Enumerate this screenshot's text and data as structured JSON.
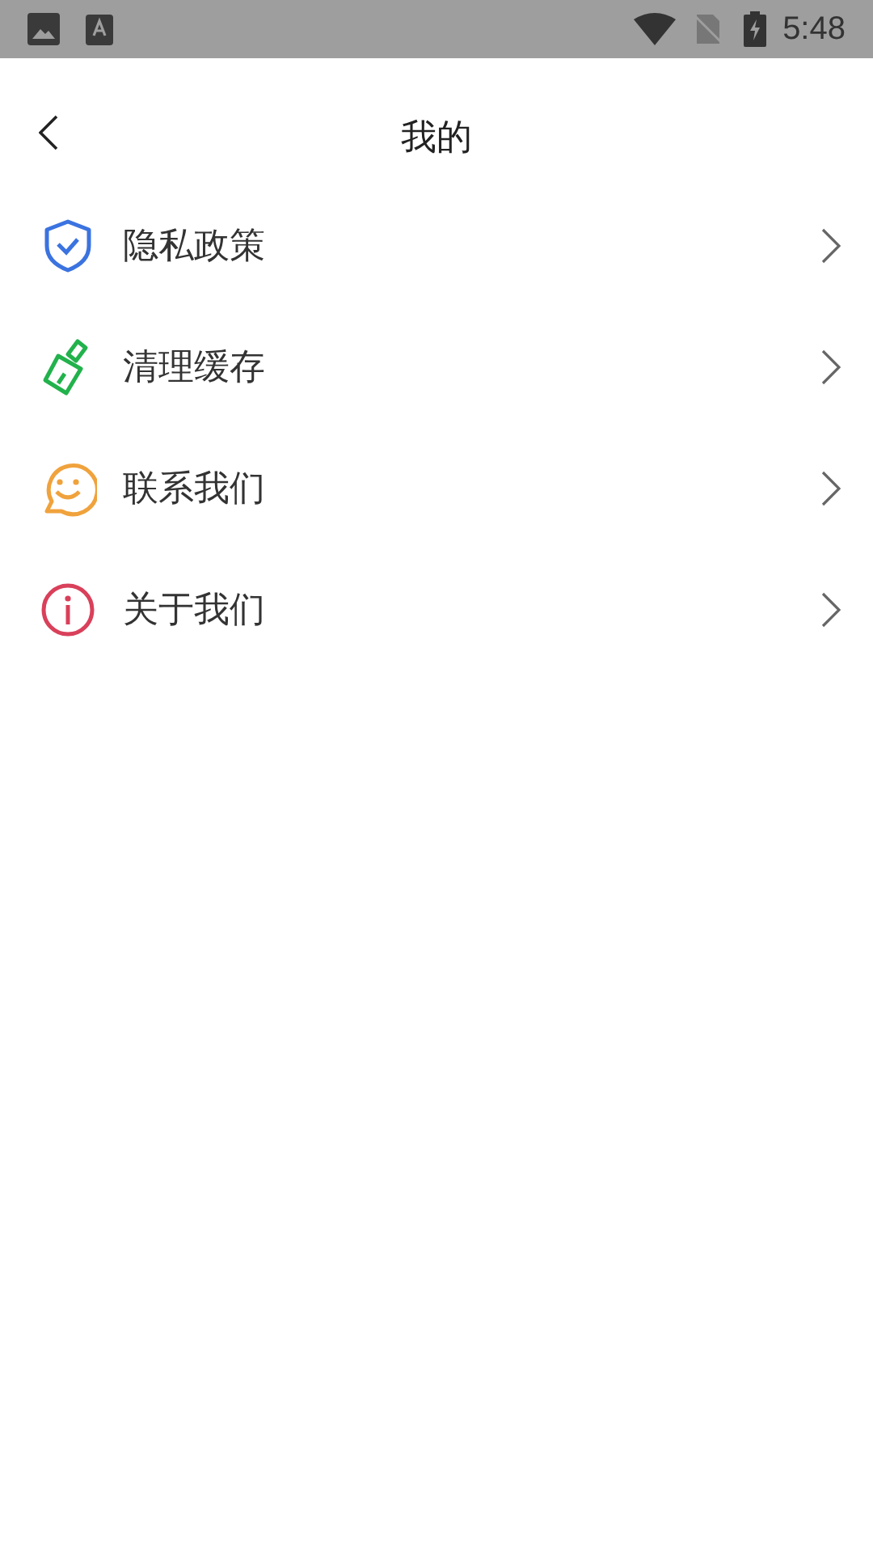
{
  "status_bar": {
    "time": "5:48"
  },
  "header": {
    "title": "我的"
  },
  "menu": [
    {
      "kind": "shield",
      "color": "#3b73e0",
      "label": "隐私政策"
    },
    {
      "kind": "brush",
      "color": "#22b24c",
      "label": "清理缓存"
    },
    {
      "kind": "smile",
      "color": "#f0a23c",
      "label": "联系我们"
    },
    {
      "kind": "info",
      "color": "#d9405a",
      "label": "关于我们"
    }
  ]
}
